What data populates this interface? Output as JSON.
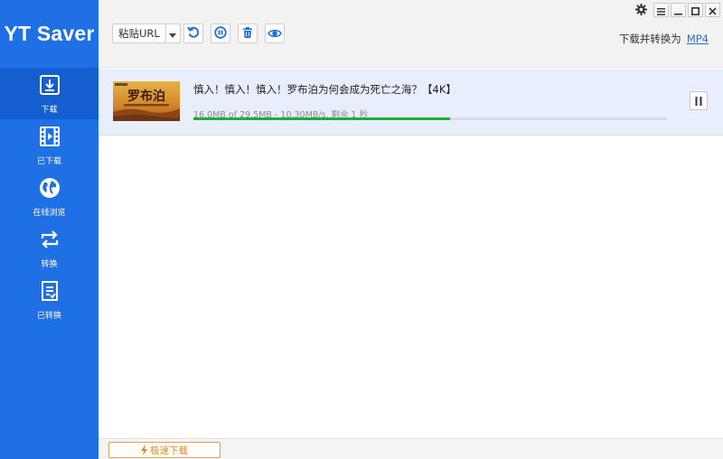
{
  "app": {
    "title": "YT Saver"
  },
  "sidebar": {
    "items": [
      {
        "label": "下载",
        "icon": "download-icon",
        "active": true
      },
      {
        "label": "已下载",
        "icon": "film-icon",
        "active": false
      },
      {
        "label": "在线浏览",
        "icon": "globe-icon",
        "active": false
      },
      {
        "label": "转换",
        "icon": "convert-arrows-icon",
        "active": false
      },
      {
        "label": "已转换",
        "icon": "converted-file-icon",
        "active": false
      }
    ]
  },
  "toolbar": {
    "paste_url_label": "粘贴URL",
    "tools": [
      "refresh-icon",
      "pause-all-icon",
      "trash-icon",
      "eye-icon"
    ]
  },
  "convert": {
    "label": "下载并转换为",
    "format": "MP4"
  },
  "download": {
    "title": "慎入！慎入！慎入！罗布泊为何会成为死亡之海？【4K】",
    "status": "16.0MB of 29.5MB -   10.30MB/s, 剩余 1 秒",
    "progress": 0.542,
    "thumbnail_text": "罗布泊"
  },
  "footer": {
    "turbo_label": "极速下载"
  },
  "colors": {
    "sidebar": "#1f6fe5",
    "accent": "#1f6fe5",
    "progress": "#1aae3c",
    "turbo": "#e08a1f"
  }
}
